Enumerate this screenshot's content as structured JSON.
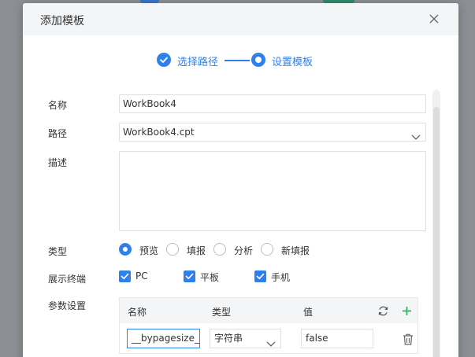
{
  "dialog": {
    "title": "添加模板"
  },
  "steps": [
    {
      "label": "选择路径",
      "state": "done"
    },
    {
      "label": "设置模板",
      "state": "current"
    }
  ],
  "form": {
    "name_label": "名称",
    "name_value": "WorkBook4",
    "path_label": "路径",
    "path_value": "WorkBook4.cpt",
    "desc_label": "描述",
    "desc_value": "",
    "type_label": "类型",
    "type_options": [
      "预览",
      "填报",
      "分析",
      "新填报"
    ],
    "type_selected": "预览",
    "terminal_label": "展示终端",
    "terminals": [
      {
        "label": "PC",
        "checked": true
      },
      {
        "label": "平板",
        "checked": true
      },
      {
        "label": "手机",
        "checked": true
      }
    ],
    "params_label": "参数设置"
  },
  "param_table": {
    "headers": [
      "名称",
      "类型",
      "值"
    ],
    "rows": [
      {
        "name": "__bypagesize__",
        "type": "字符串",
        "value": "false"
      }
    ]
  },
  "icons": {
    "close": "close-icon",
    "check": "check-icon",
    "refresh": "refresh-icon",
    "add": "plus-icon",
    "delete": "trash-icon",
    "dropdown": "chevron-down-icon"
  },
  "colors": {
    "accent": "#2f80ed",
    "add": "#2fb35a"
  }
}
